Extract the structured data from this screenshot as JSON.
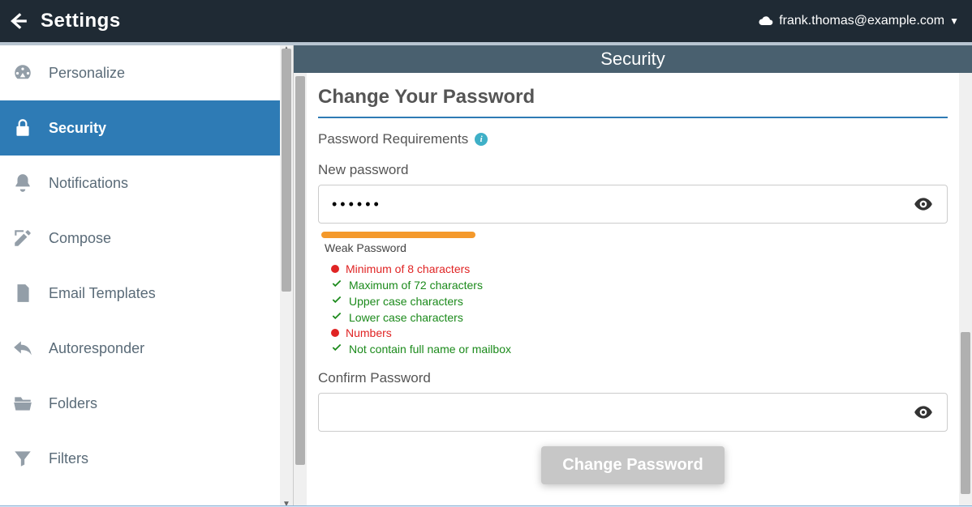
{
  "header": {
    "title": "Settings",
    "user_email": "frank.thomas@example.com"
  },
  "sidebar": {
    "items": [
      {
        "label": "Personalize",
        "icon": "gauge-icon"
      },
      {
        "label": "Security",
        "icon": "lock-icon"
      },
      {
        "label": "Notifications",
        "icon": "bell-icon"
      },
      {
        "label": "Compose",
        "icon": "compose-icon"
      },
      {
        "label": "Email Templates",
        "icon": "document-icon"
      },
      {
        "label": "Autoresponder",
        "icon": "reply-icon"
      },
      {
        "label": "Folders",
        "icon": "folder-icon"
      },
      {
        "label": "Filters",
        "icon": "funnel-icon"
      }
    ],
    "active_index": 1
  },
  "content": {
    "page_title": "Security",
    "section_title": "Change Your Password",
    "requirements_label": "Password Requirements",
    "new_password_label": "New password",
    "new_password_value": "••••••",
    "strength_label": "Weak Password",
    "strength_color": "#f4992b",
    "rules": [
      {
        "ok": false,
        "text": "Minimum of 8 characters"
      },
      {
        "ok": true,
        "text": "Maximum of 72 characters"
      },
      {
        "ok": true,
        "text": "Upper case characters"
      },
      {
        "ok": true,
        "text": "Lower case characters"
      },
      {
        "ok": false,
        "text": "Numbers"
      },
      {
        "ok": true,
        "text": "Not contain full name or mailbox"
      }
    ],
    "confirm_password_label": "Confirm Password",
    "confirm_password_value": "",
    "submit_label": "Change Password"
  }
}
